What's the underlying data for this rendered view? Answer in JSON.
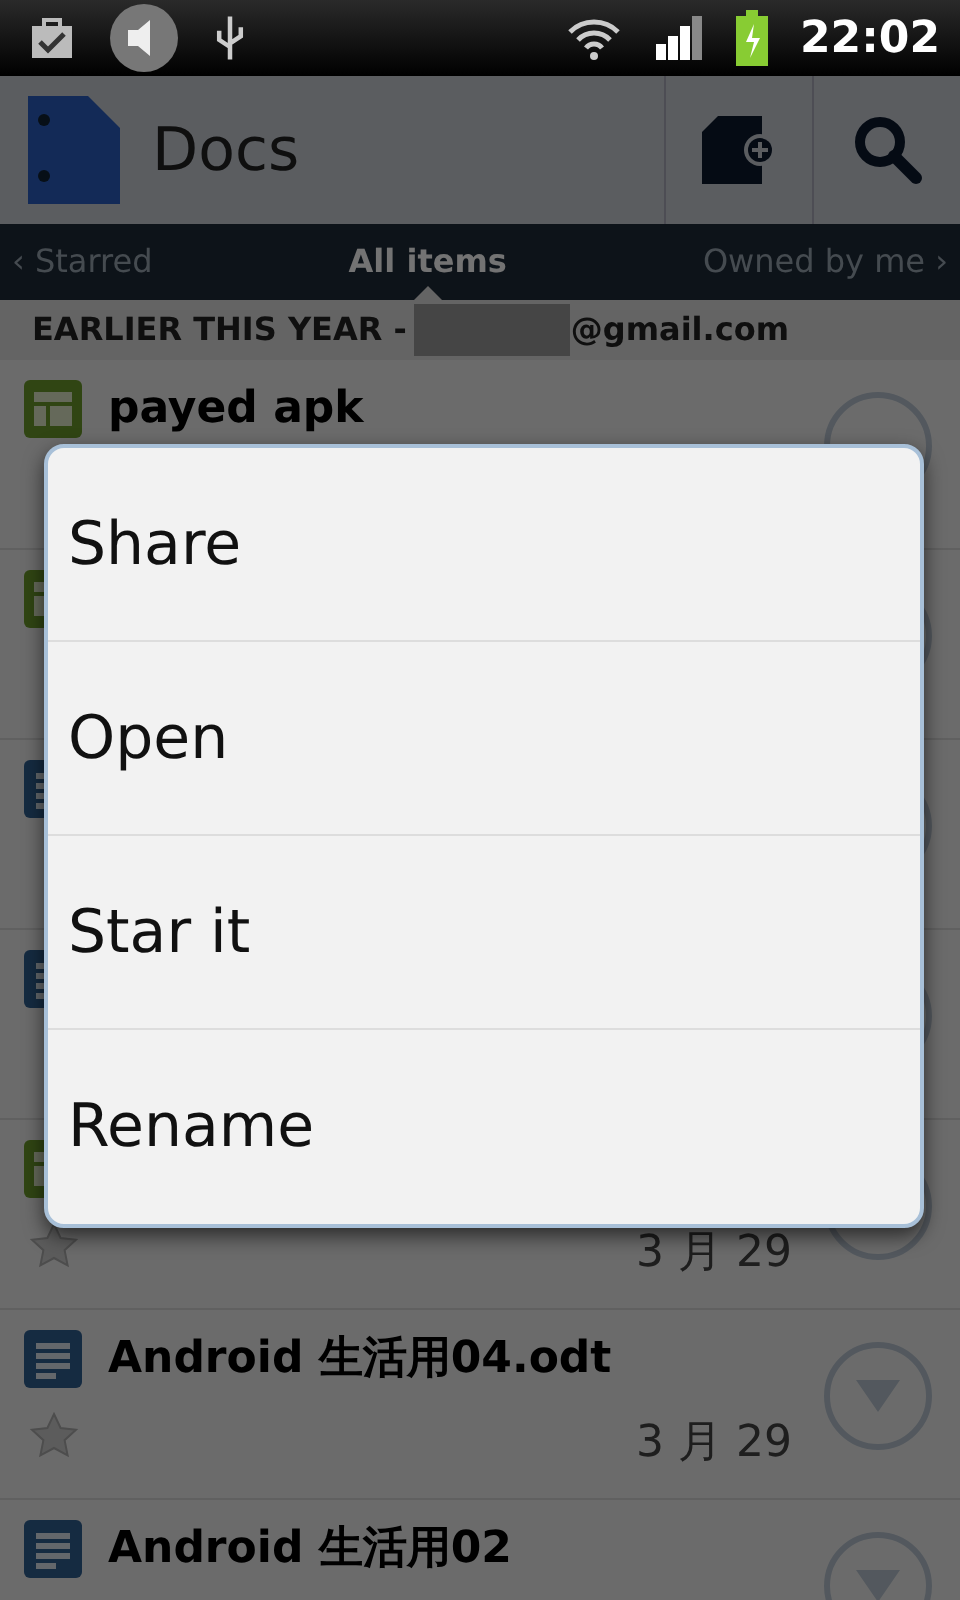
{
  "status_bar": {
    "time": "22:02"
  },
  "action_bar": {
    "title": "Docs"
  },
  "tabs": [
    {
      "label": "‹ Starred",
      "selected": false
    },
    {
      "label": "All items",
      "selected": true
    },
    {
      "label": "Owned by me ›",
      "selected": false
    }
  ],
  "section_header": {
    "label": "EARLIER THIS YEAR -",
    "account": "@gmail.com"
  },
  "documents": [
    {
      "kind": "spreadsheet",
      "title": "payed apk"
    },
    {
      "kind": "spreadsheet"
    },
    {
      "kind": "document"
    },
    {
      "kind": "document"
    },
    {
      "kind": "spreadsheet",
      "date": "3 月 29"
    },
    {
      "kind": "document",
      "title": "Android 生活用04.odt",
      "date": "3 月 29"
    },
    {
      "kind": "document",
      "title": "Android 生活用02"
    }
  ],
  "context_menu": {
    "items": [
      "Share",
      "Open",
      "Star it",
      "Rename"
    ]
  }
}
